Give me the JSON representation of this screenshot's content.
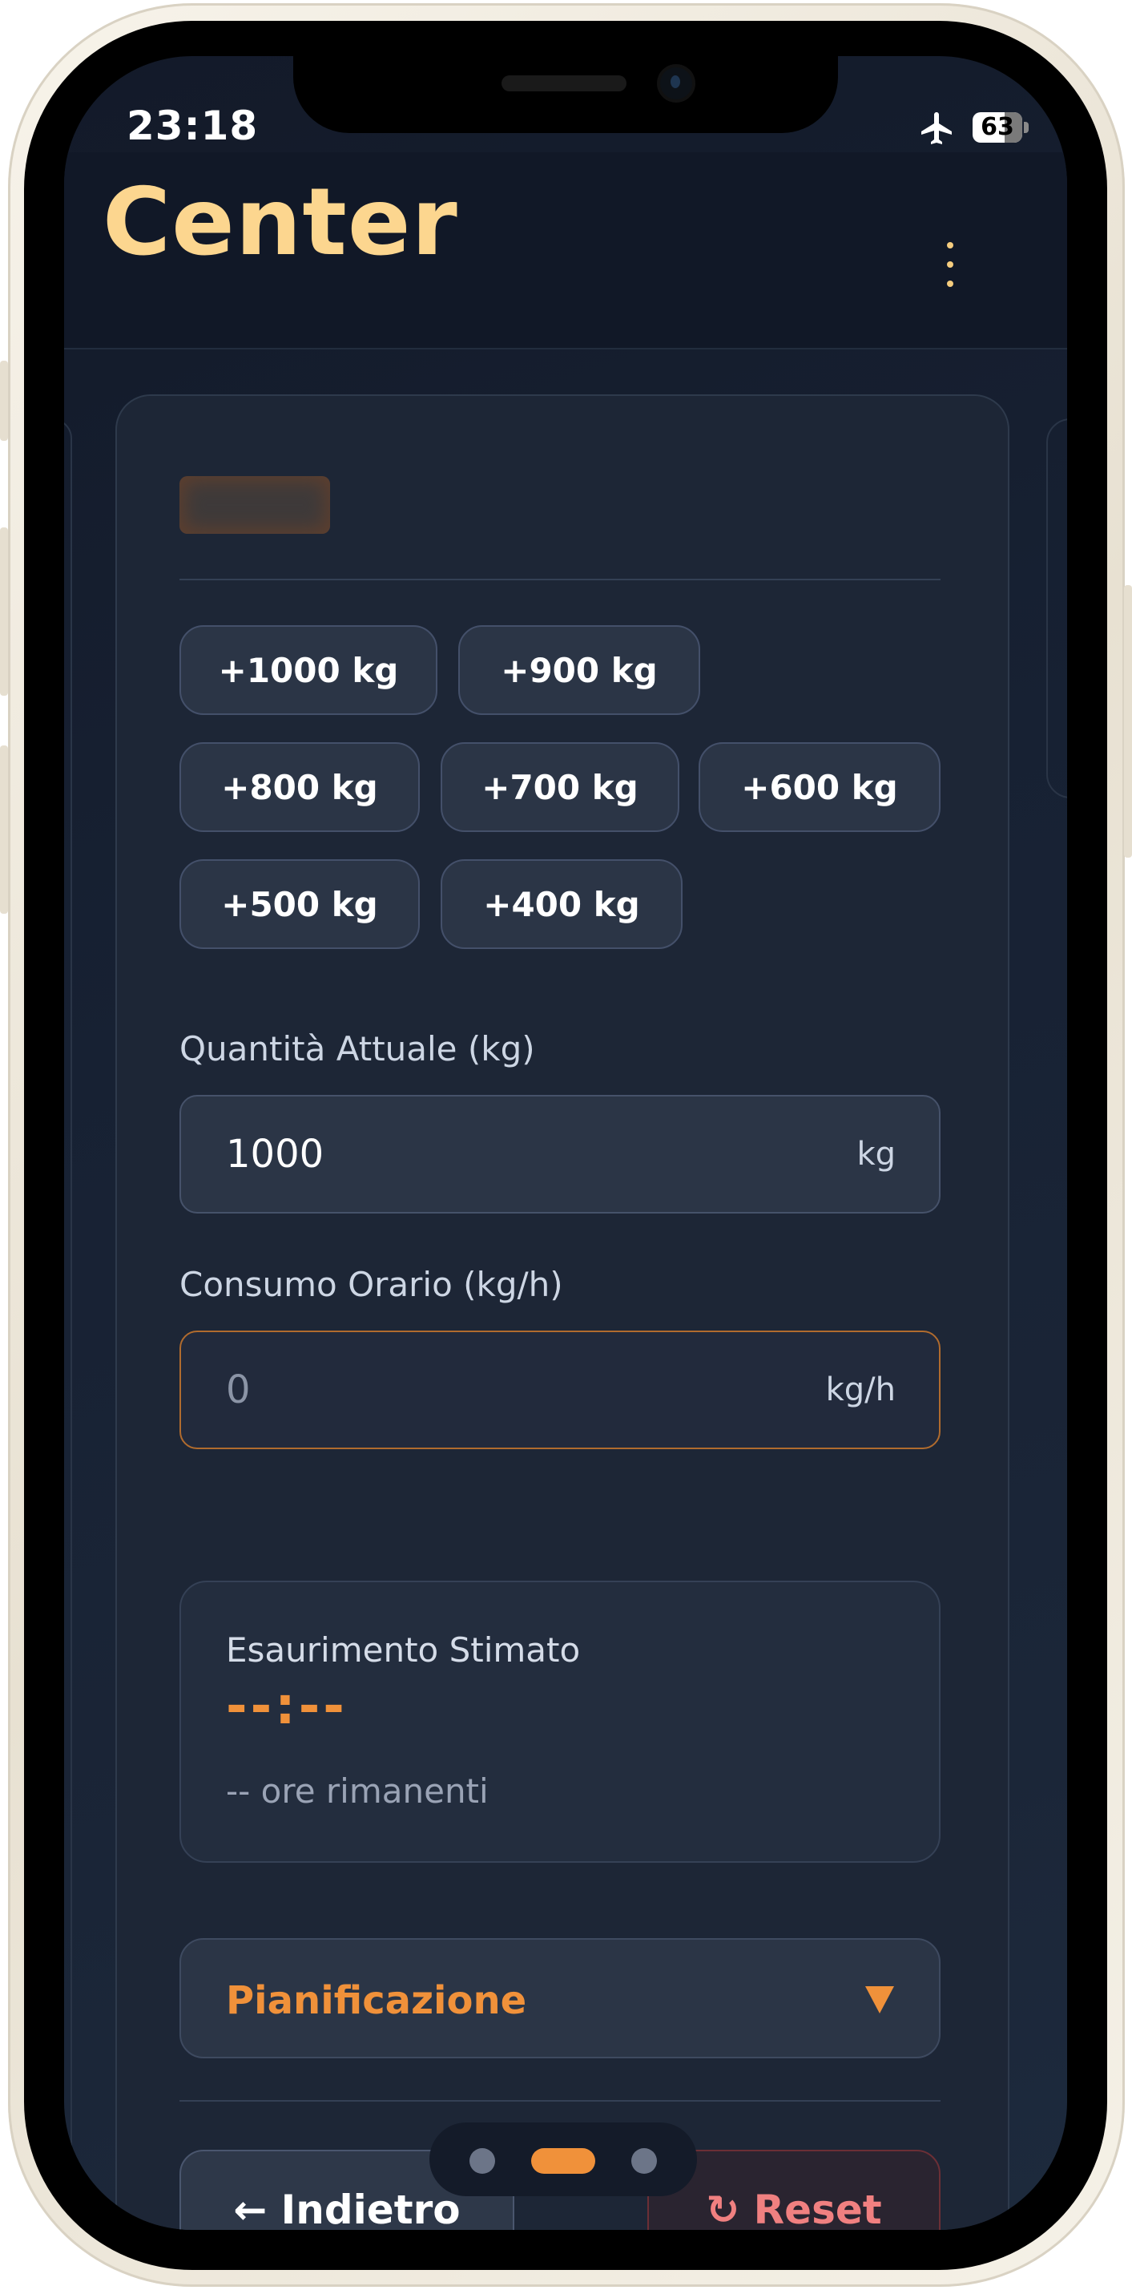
{
  "status_bar": {
    "time": "23:18",
    "battery": "63"
  },
  "header": {
    "title": "Center",
    "menu_icon": "more-vertical-icon"
  },
  "quick_add": {
    "chips": [
      "+1000 kg",
      "+900 kg",
      "+800 kg",
      "+700 kg",
      "+600 kg",
      "+500 kg",
      "+400 kg"
    ]
  },
  "quantity": {
    "label": "Quantità Attuale (kg)",
    "value": "1000",
    "unit": "kg"
  },
  "consumption": {
    "label": "Consumo Orario (kg/h)",
    "placeholder": "0",
    "unit": "kg/h"
  },
  "estimate": {
    "title": "Esaurimento Stimato",
    "value": "--:--",
    "remaining": "-- ore rimanenti"
  },
  "planning": {
    "label": "Pianificazione"
  },
  "actions": {
    "back_label": "Indietro",
    "reset_label": "Reset"
  },
  "pager": {
    "total": 3,
    "active_index": 1
  },
  "colors": {
    "accent": "#f0913a",
    "title": "#fcd68f",
    "danger": "#f08080"
  }
}
